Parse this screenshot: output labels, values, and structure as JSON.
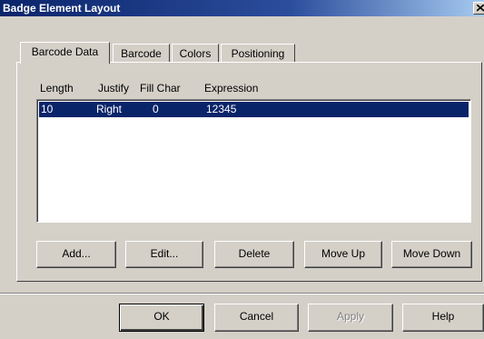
{
  "window": {
    "title": "Badge Element Layout"
  },
  "tabs": [
    {
      "label": "Barcode Data",
      "active": true
    },
    {
      "label": "Barcode",
      "active": false
    },
    {
      "label": "Colors",
      "active": false
    },
    {
      "label": "Positioning",
      "active": false
    }
  ],
  "list": {
    "columns": [
      "Length",
      "Justify",
      "Fill Char",
      "Expression"
    ],
    "rows": [
      {
        "length": "10",
        "justify": "Right",
        "fill_char": "0",
        "expression": "12345",
        "selected": true
      }
    ]
  },
  "list_buttons": {
    "add": "Add...",
    "edit": "Edit...",
    "delete": "Delete",
    "move_up": "Move Up",
    "move_down": "Move Down"
  },
  "dialog_buttons": {
    "ok": "OK",
    "cancel": "Cancel",
    "apply": "Apply",
    "help": "Help"
  },
  "colors": {
    "title_bar": "#0a246a",
    "selection": "#0a246a",
    "face": "#d4d0c8"
  }
}
